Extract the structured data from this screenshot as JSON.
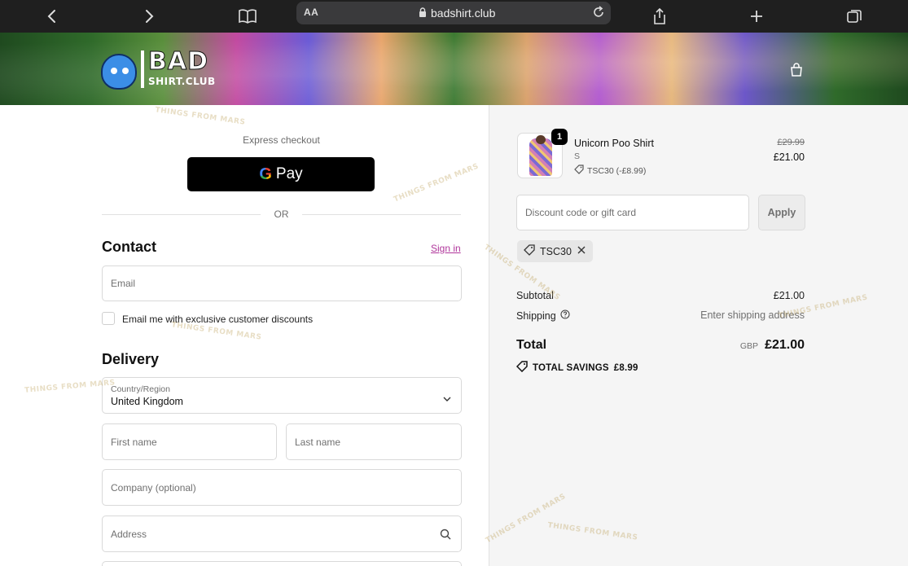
{
  "browser": {
    "aa_label": "AA",
    "domain": "badshirt.club"
  },
  "brand": {
    "logo_line1": "BAD",
    "logo_line2": "SHIRT.CLUB"
  },
  "express": {
    "label": "Express checkout",
    "gpay_g": "G",
    "gpay_label": "Pay",
    "or": "OR"
  },
  "contact": {
    "heading": "Contact",
    "signin": "Sign in",
    "email_placeholder": "Email",
    "marketing_label": "Email me with exclusive customer discounts"
  },
  "delivery": {
    "heading": "Delivery",
    "country_label": "Country/Region",
    "country_value": "United Kingdom",
    "first_name": "First name",
    "last_name": "Last name",
    "company": "Company (optional)",
    "address": "Address"
  },
  "summary": {
    "item": {
      "qty": "1",
      "name": "Unicorn Poo Shirt",
      "variant": "S",
      "discount": "TSC30 (-£8.99)",
      "old_price": "£29.99",
      "price": "£21.00"
    },
    "discount_placeholder": "Discount code or gift card",
    "apply_label": "Apply",
    "applied_code": "TSC30",
    "subtotal_label": "Subtotal",
    "subtotal_value": "£21.00",
    "shipping_label": "Shipping",
    "shipping_value": "Enter shipping address",
    "total_label": "Total",
    "currency": "GBP",
    "total_value": "£21.00",
    "savings_label": "TOTAL SAVINGS",
    "savings_value": "£8.99"
  },
  "watermark": "THINGS FROM MARS",
  "colors": {
    "accent": "#b0369b",
    "chrome": "#1f1f1f"
  }
}
